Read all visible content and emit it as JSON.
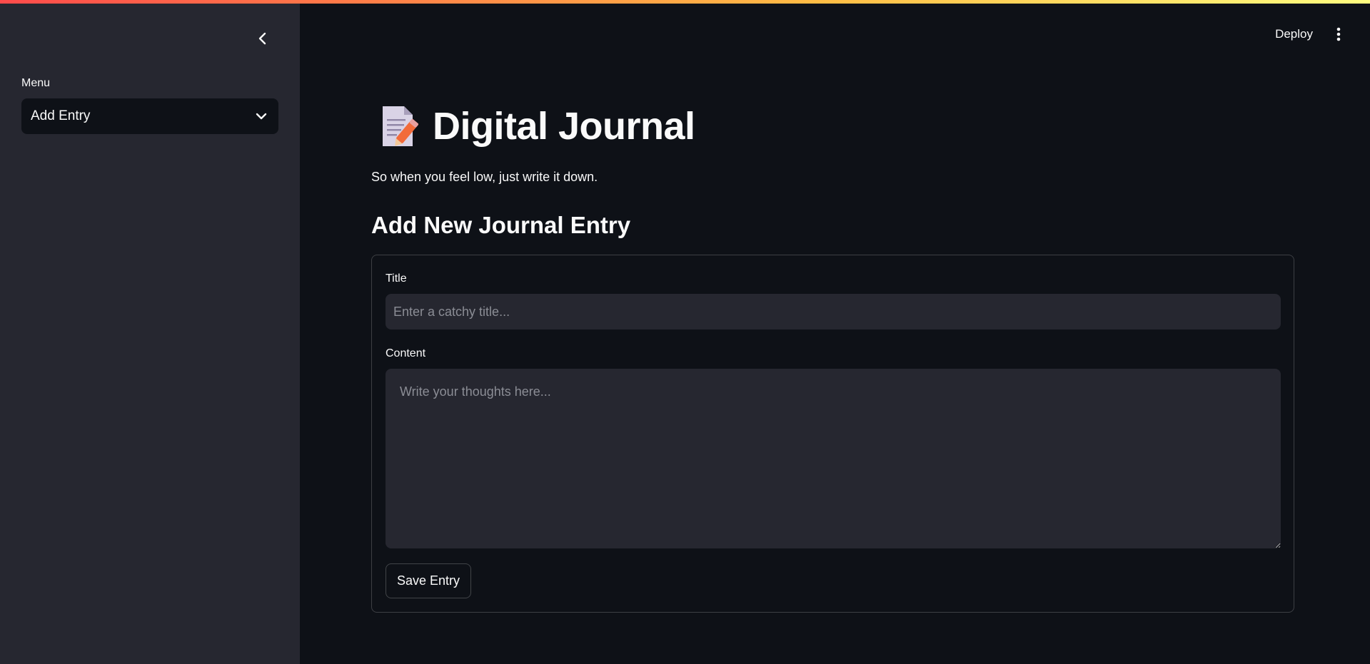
{
  "colors": {
    "background": "#0e1117",
    "sidebar": "#262730",
    "input_bg": "#262730",
    "text": "#fafafa",
    "placeholder": "#8b8d95",
    "accent_gradient_start": "#ff4b4b",
    "accent_gradient_end": "#fffd80"
  },
  "sidebar": {
    "collapse_icon": "chevron-left-icon",
    "menu_label": "Menu",
    "menu_selected": "Add Entry",
    "menu_icon": "chevron-down-icon"
  },
  "header": {
    "deploy_label": "Deploy",
    "more_icon": "vertical-ellipsis-icon"
  },
  "main": {
    "title_icon": "memo-pencil-icon",
    "title": "Digital Journal",
    "subtitle": "So when you feel low, just write it down.",
    "section_heading": "Add New Journal Entry",
    "form": {
      "title_label": "Title",
      "title_placeholder": "Enter a catchy title...",
      "title_value": "",
      "content_label": "Content",
      "content_placeholder": "Write your thoughts here...",
      "content_value": "",
      "save_label": "Save Entry"
    }
  }
}
